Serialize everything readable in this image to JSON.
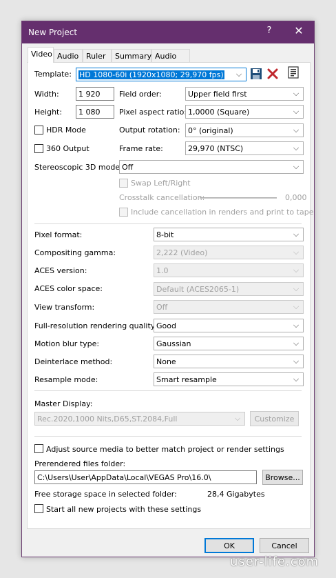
{
  "window": {
    "title": "New Project",
    "help_glyph": "?",
    "close_glyph": "✕"
  },
  "tabs": [
    {
      "label": "Video"
    },
    {
      "label": "Audio"
    },
    {
      "label": "Ruler"
    },
    {
      "label": "Summary"
    },
    {
      "label": "Audio CD"
    }
  ],
  "template": {
    "label": "Template:",
    "value": "HD 1080-60i (1920x1080; 29,970 fps)"
  },
  "width": {
    "label": "Width:",
    "value": "1 920"
  },
  "height": {
    "label": "Height:",
    "value": "1 080"
  },
  "field_order": {
    "label": "Field order:",
    "value": "Upper field first"
  },
  "pixel_aspect": {
    "label": "Pixel aspect ratio:",
    "value": "1,0000 (Square)"
  },
  "hdr_mode": {
    "label": "HDR Mode",
    "checked": false
  },
  "output_rotation": {
    "label": "Output rotation:",
    "value": "0° (original)"
  },
  "output_360": {
    "label": "360 Output",
    "checked": false
  },
  "frame_rate": {
    "label": "Frame rate:",
    "value": "29,970 (NTSC)"
  },
  "stereo_3d": {
    "label": "Stereoscopic 3D mode:",
    "value": "Off"
  },
  "swap": {
    "label": "Swap Left/Right"
  },
  "crosstalk": {
    "label": "Crosstalk cancellation:",
    "value": "0,000"
  },
  "include_cancel": {
    "label": "Include cancellation in renders and print to tape"
  },
  "pixel_format": {
    "label": "Pixel format:",
    "value": "8-bit"
  },
  "compositing_gamma": {
    "label": "Compositing gamma:",
    "value": "2,222 (Video)"
  },
  "aces_version": {
    "label": "ACES version:",
    "value": "1.0"
  },
  "aces_color_space": {
    "label": "ACES color space:",
    "value": "Default (ACES2065-1)"
  },
  "view_transform": {
    "label": "View transform:",
    "value": "Off"
  },
  "full_res_quality": {
    "label": "Full-resolution rendering quality:",
    "value": "Good"
  },
  "motion_blur": {
    "label": "Motion blur type:",
    "value": "Gaussian"
  },
  "deinterlace": {
    "label": "Deinterlace method:",
    "value": "None"
  },
  "resample": {
    "label": "Resample mode:",
    "value": "Smart resample"
  },
  "master_display": {
    "label": "Master Display:",
    "value": "Rec.2020,1000 Nits,D65,ST.2084,Full",
    "customize_label": "Customize"
  },
  "adjust_source": {
    "label": "Adjust source media to better match project or render settings",
    "checked": false
  },
  "prerendered": {
    "label": "Prerendered files folder:",
    "value": "C:\\Users\\User\\AppData\\Local\\VEGAS Pro\\16.0\\",
    "browse_label": "Browse..."
  },
  "free_storage": {
    "label": "Free storage space in selected folder:",
    "value": "28,4 Gigabytes"
  },
  "start_all": {
    "label": "Start all new projects with these settings",
    "checked": false
  },
  "footer": {
    "ok_label": "OK",
    "cancel_label": "Cancel"
  },
  "watermark": "user-life.com",
  "colors": {
    "titlebar": "#652f6e",
    "accent": "#0078d7",
    "delete_icon": "#c0272d",
    "save_icon": "#1f4e79"
  }
}
